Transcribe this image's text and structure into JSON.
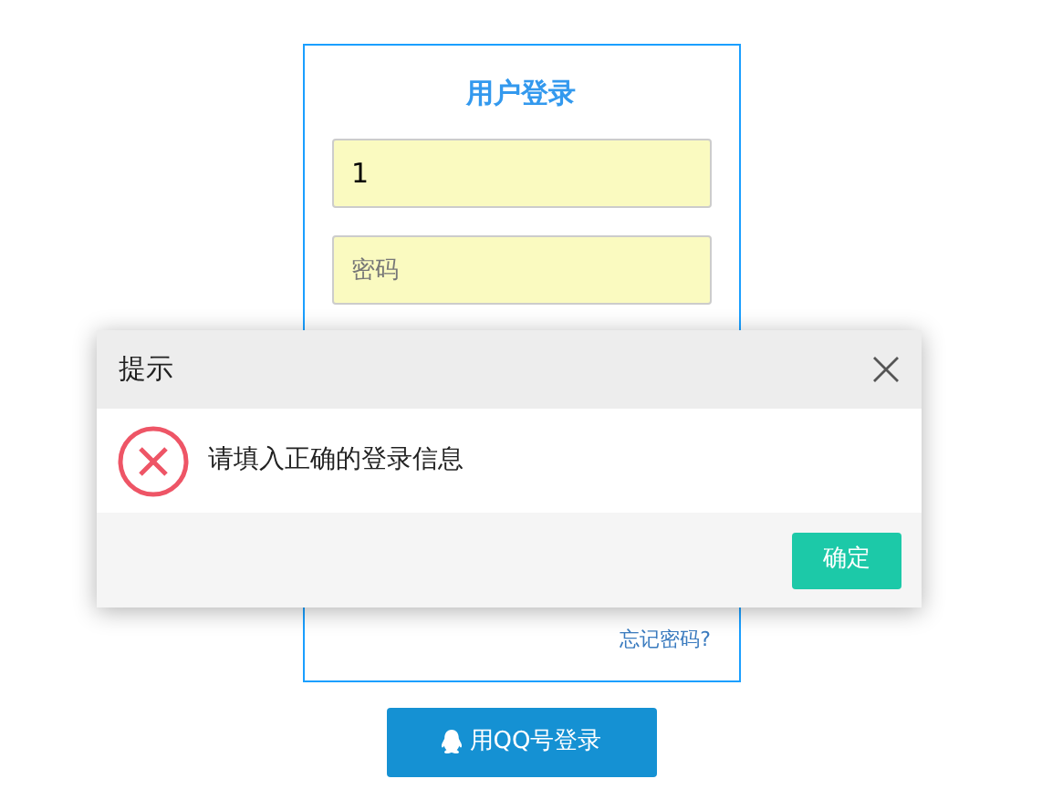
{
  "login": {
    "title": "用户登录",
    "username": {
      "value": "1"
    },
    "password": {
      "placeholder": "密码"
    },
    "forgot_link": "忘记密码?",
    "qq_button": "用QQ号登录"
  },
  "dialog": {
    "title": "提示",
    "kind": "error",
    "message": "请填入正确的登录信息",
    "ok_button": "确定"
  }
}
